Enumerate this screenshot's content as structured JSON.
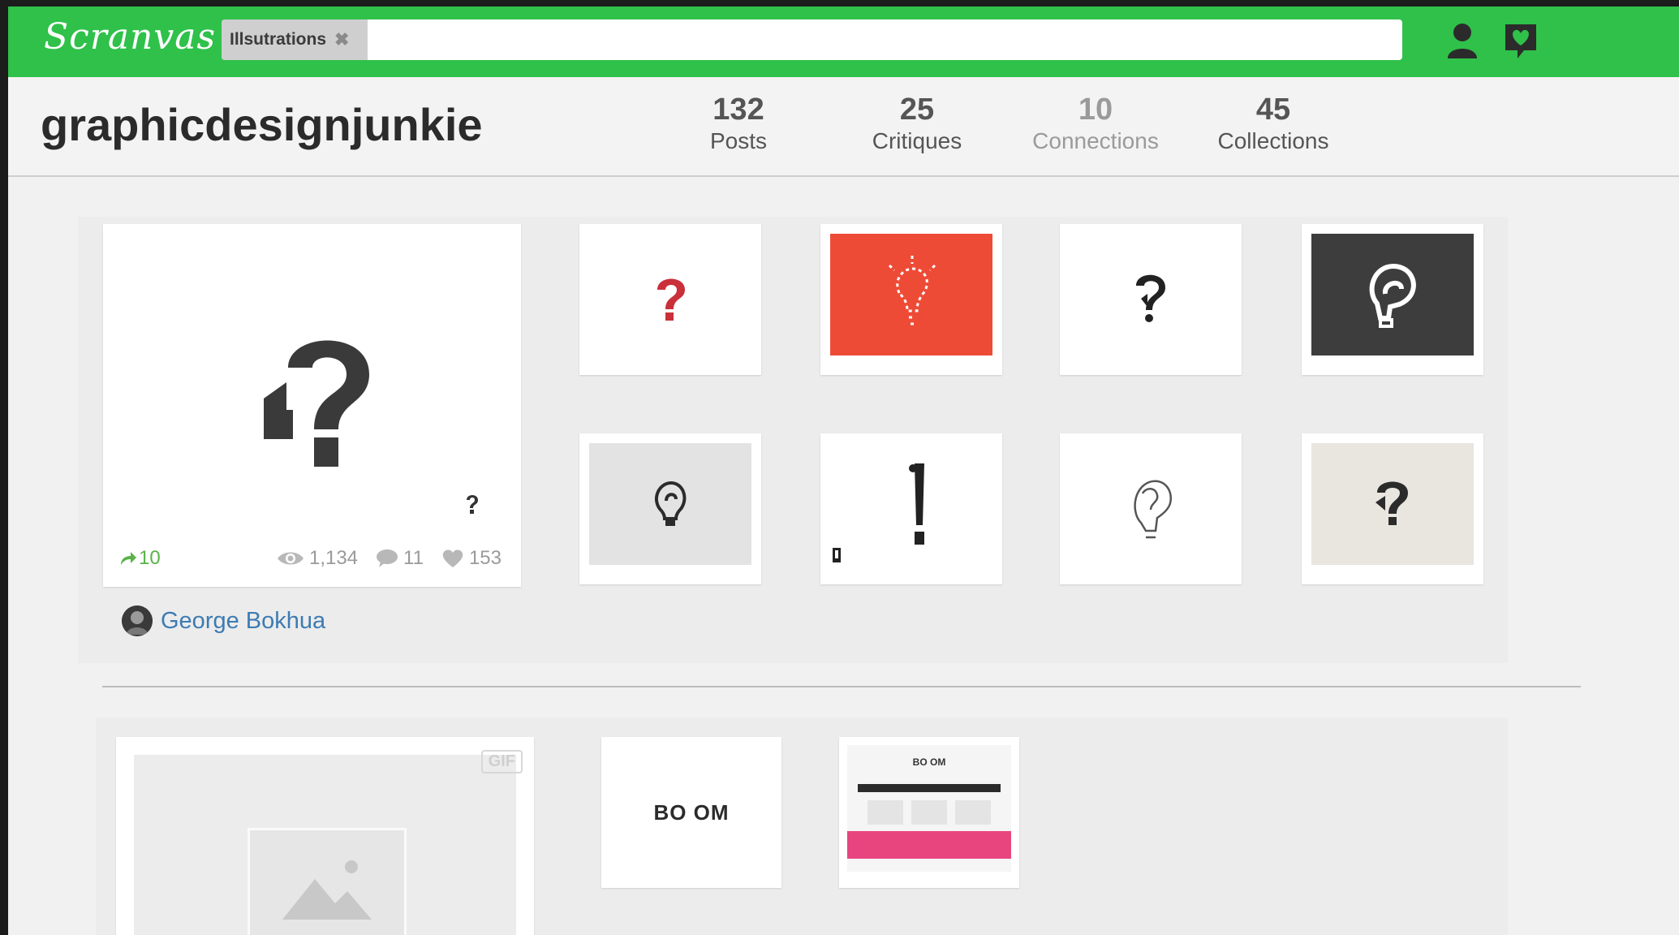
{
  "app": {
    "logo": "Scranvas"
  },
  "search": {
    "tag_label": "Illsutrations",
    "tag_remove": "✖",
    "value": ""
  },
  "header_icons": {
    "user": "user-icon",
    "notifications": "heart-chat-icon"
  },
  "profile": {
    "username": "graphicdesignjunkie",
    "stats": [
      {
        "value": "132",
        "label": "Posts"
      },
      {
        "value": "25",
        "label": "Critiques"
      },
      {
        "value": "10",
        "label": "Connections"
      },
      {
        "value": "45",
        "label": "Collections"
      }
    ]
  },
  "collections": [
    {
      "featured": {
        "reposts": "10",
        "views": "1,134",
        "comments": "11",
        "likes": "153"
      },
      "author": "George Bokhua",
      "thumbs": [
        {
          "icon": "question-mark-red-icon",
          "bg": "#ffffff"
        },
        {
          "icon": "lightbulb-question-icon",
          "bg": "#ee4b36"
        },
        {
          "icon": "question-mark-icon",
          "bg": "#ffffff"
        },
        {
          "icon": "question-bulb-dark-icon",
          "bg": "#3d3d3d"
        },
        {
          "icon": "bulb-outline-icon",
          "bg": "#e3e3e3"
        },
        {
          "icon": "exclamation-mark-icon",
          "bg": "#ffffff"
        },
        {
          "icon": "head-profile-icon",
          "bg": "#ffffff"
        },
        {
          "icon": "question-mark-paper-icon",
          "bg": "#e8e6df"
        }
      ]
    },
    {
      "featured": {
        "badge": "GIF"
      },
      "thumbs": [
        {
          "text": "BO OM",
          "icon": "booom-logo-icon"
        },
        {
          "text": "BO OM",
          "icon": "booom-site-preview-icon"
        }
      ]
    }
  ],
  "colors": {
    "brand_green": "#2fc14a",
    "link_blue": "#3d7bb3",
    "accent_red": "#ee4b36",
    "accent_pink": "#e8457f"
  }
}
